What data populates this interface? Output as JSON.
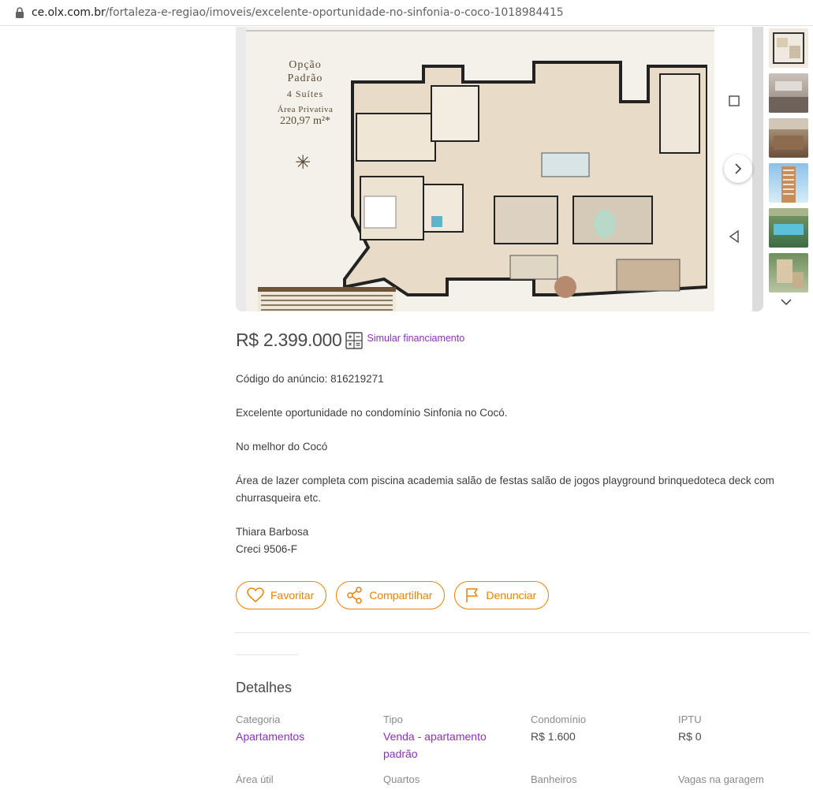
{
  "browser": {
    "url_host": "ce.olx.com.br",
    "url_path": "/fortaleza-e-regiao/imoveis/excelente-oportunidade-no-sinfonia-o-coco-1018984415"
  },
  "gallery": {
    "plan_title_line1": "Opção",
    "plan_title_line2": "Padrão",
    "plan_title_line3": "4 Suítes",
    "plan_title_line4": "Área Privativa",
    "plan_title_line5": "220,97 m²*",
    "thumbnail_count": 6
  },
  "listing": {
    "price": "R$ 2.399.000",
    "simulate_label": "Simular financiamento",
    "code_line": "Código do anúncio: 816219271",
    "desc_1": "Excelente oportunidade no condomínio Sinfonia no Cocó.",
    "desc_2": "No melhor do Cocó",
    "desc_3a": "Área de lazer completa com piscina academia salão de festas salão de jogos playground brinquedoteca deck com",
    "desc_3b": "churrasqueira etc.",
    "desc_4a": "Thiara Barbosa",
    "desc_4b": "Creci 9506-F"
  },
  "actions": {
    "favorite": "Favoritar",
    "share": "Compartilhar",
    "report": "Denunciar"
  },
  "colors": {
    "accent_orange": "#f28000",
    "link_purple": "#8e2fbf"
  },
  "details": {
    "title": "Detalhes",
    "items": [
      {
        "label": "Categoria",
        "value": "Apartamentos",
        "link": true
      },
      {
        "label": "Tipo",
        "value": "Venda - apartamento padrão",
        "link": true
      },
      {
        "label": "Condomínio",
        "value": "R$ 1.600",
        "link": false
      },
      {
        "label": "IPTU",
        "value": "R$ 0",
        "link": false
      },
      {
        "label": "Área útil",
        "value": "",
        "link": false
      },
      {
        "label": "Quartos",
        "value": "",
        "link": false
      },
      {
        "label": "Banheiros",
        "value": "",
        "link": false
      },
      {
        "label": "Vagas na garagem",
        "value": "",
        "link": false
      }
    ]
  }
}
